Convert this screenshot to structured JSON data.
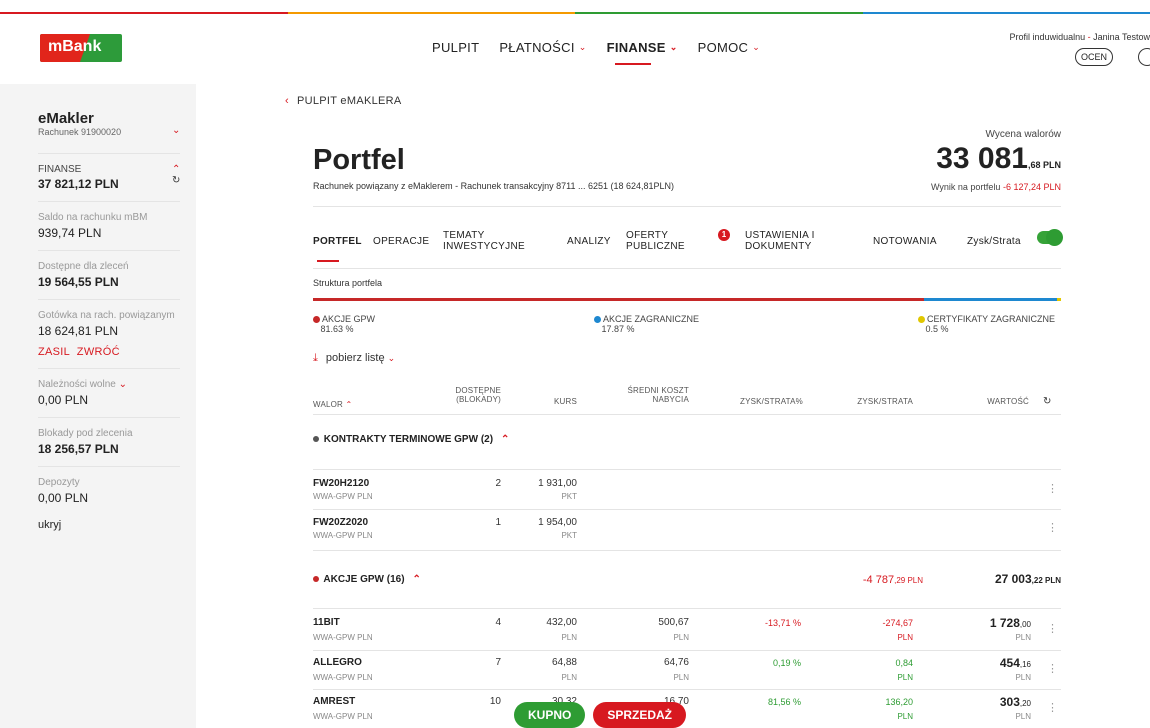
{
  "colors": {
    "accent": "#d71920",
    "green": "#2e9c33",
    "stripe": [
      "#d71920",
      "#f49a00",
      "#2e9c33",
      "#1e88d0"
    ],
    "bar": [
      "#c62828",
      "#1e88d0",
      "#e0c700"
    ]
  },
  "header": {
    "logo": "mBank",
    "nav": [
      "PULPIT",
      "PŁATNOŚCI",
      "FINANSE",
      "POMOC"
    ],
    "profile_type": "Profil induwidualnu",
    "profile_name": "Janina Testow",
    "rate_button": "OCEN"
  },
  "sidebar": {
    "title": "eMakler",
    "account": "Rachunek 91900020",
    "finanse_label": "FINANSE",
    "finanse_value": "37 821,12 PLN",
    "saldo_label": "Saldo na rachunku mBM",
    "saldo_value": "939,74 PLN",
    "dostepne_label": "Dostępne dla zleceń",
    "dostepne_value": "19 564,55 PLN",
    "gotowka_label": "Gotówka na rach. powiązanym",
    "gotowka_value": "18 624,81 PLN",
    "zasil": "ZASIL",
    "zwroc": "ZWRÓĆ",
    "naleznosci_label": "Należności wolne",
    "naleznosci_value": "0,00 PLN",
    "blokady_label": "Blokady pod zlecenia",
    "blokady_value": "18 256,57 PLN",
    "depozyty_label": "Depozyty",
    "depozyty_value": "0,00 PLN",
    "hide": "ukryj"
  },
  "main": {
    "back": "PULPIT eMAKLERA",
    "title": "Portfel",
    "subtitle": "Rachunek powiązany z eMaklerem - Rachunek transakcyjny 8711 ... 6251 (18 624,81PLN)",
    "wycena_label": "Wycena walorów",
    "wycena_main": "33 081",
    "wycena_small": ",68 PLN",
    "wynik_label": "Wynik na portfelu",
    "wynik_value": "-6 127,24 PLN",
    "tabs": [
      "PORTFEL",
      "OPERACJE",
      "TEMATY",
      "INWESTYCYJNE",
      "ANALIZY",
      "OFERTY",
      "PUBLICZNE",
      "USTAWIENIA I",
      "DOKUMENTY",
      "NOTOWANIA",
      "Zysk/Strata"
    ],
    "badge": "1",
    "structure_label": "Struktura portfela",
    "structure": [
      {
        "name": "AKCJE GPW",
        "pct": "81.63 %",
        "share": 81.63
      },
      {
        "name": "AKCJE ZAGRANICZNE",
        "pct": "17.87 %",
        "share": 17.87
      },
      {
        "name": "CERTYFIKATY ZAGRANICZNE",
        "pct": "0.5 %",
        "share": 0.5
      }
    ],
    "download": "pobierz listę",
    "columns": [
      "WALOR",
      "DOSTĘPNE",
      "(BLOKADY)",
      "KURS",
      "ŚREDNI KOSZT",
      "NABYCIA",
      "ZYSK/STRATA%",
      "ZYSK/STRATA",
      "WARTOŚĆ"
    ],
    "group1": {
      "name": "KONTRAKTY TERMINOWE GPW (2)"
    },
    "futures": [
      {
        "name": "FW20H2120",
        "market": "WWA-GPW PLN",
        "qty": "2",
        "price": "1 931,00",
        "unit": "PKT"
      },
      {
        "name": "FW20Z2020",
        "market": "WWA-GPW PLN",
        "qty": "1",
        "price": "1 954,00",
        "unit": "PKT"
      }
    ],
    "group2": {
      "name": "AKCJE GPW (16)",
      "result_main": "-4 787",
      "result_small": ",29 PLN",
      "value_main": "27 003",
      "value_small": ",22 PLN"
    },
    "stocks": [
      {
        "name": "11BIT",
        "market": "WWA-GPW PLN",
        "qty": "4",
        "price": "432,00",
        "avg": "500,67",
        "pct": "-13,71 %",
        "pnl": "-274,67",
        "val_main": "1 728",
        "val_small": ",00",
        "cur": "PLN"
      },
      {
        "name": "ALLEGRO",
        "market": "WWA-GPW PLN",
        "qty": "7",
        "price": "64,88",
        "avg": "64,76",
        "pct": "0,19 %",
        "pnl": "0,84",
        "val_main": "454",
        "val_small": ",16",
        "cur": "PLN"
      },
      {
        "name": "AMREST",
        "market": "WWA-GPW PLN",
        "qty": "10",
        "price": "30,32",
        "avg": "16,70",
        "pct": "81,56 %",
        "pnl": "136,20",
        "val_main": "303",
        "val_small": ",20",
        "cur": "PLN"
      }
    ],
    "buy": "KUPNO",
    "sell": "SPRZEDAŻ"
  }
}
